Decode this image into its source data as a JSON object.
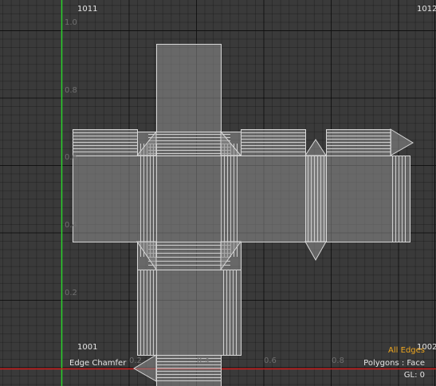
{
  "tile_labels": {
    "top_left": "1011",
    "top_right": "1012",
    "bottom_left": "1001",
    "bottom_right": "1002"
  },
  "v_ticks": [
    "1.0",
    "0.8",
    "0.6",
    "0.4",
    "0.2"
  ],
  "u_ticks": [
    "0.2",
    "0.4",
    "0.6",
    "0.8"
  ],
  "status": {
    "tool": "Edge Chamfer",
    "selection": "All Edges",
    "mode": "Polygons : Face",
    "gl": "GL: 0"
  },
  "colors": {
    "background": "#3a3a3a",
    "green_axis": "#2bd12b",
    "red_axis": "#d01e1e",
    "selection_label": "#f0a81f",
    "uv_wire": "#d8d8d8"
  }
}
